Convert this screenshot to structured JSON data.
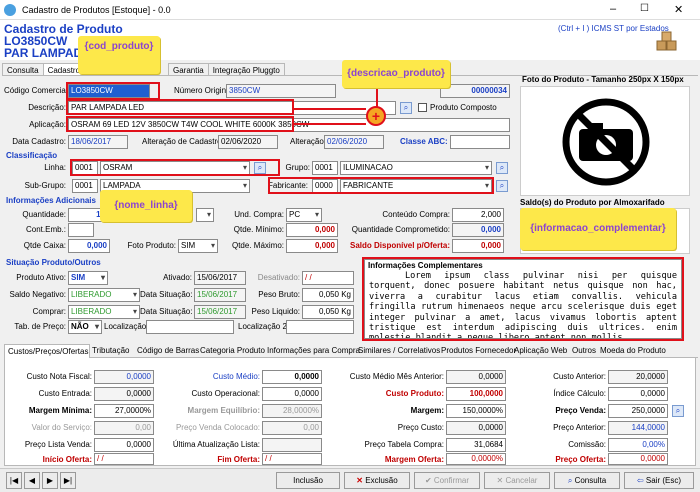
{
  "window": {
    "title": "Cadastro de Produtos [Estoque] - 0.0"
  },
  "header": {
    "title": "Cadastro de Produto",
    "code": "LO3850CW",
    "name": "PAR LAMPADA LED",
    "hint": "(Ctrl + I ) ICMS ST por Estados"
  },
  "top_tabs": [
    "Consulta",
    "Cadastro d",
    "Garantia",
    "Integração Pluggto"
  ],
  "callouts": {
    "cod_produto": "{cod_produto}",
    "descricao_produto": "{descricao_produto}",
    "nome_linha": "{nome_linha}",
    "informacao_complementar": "{informacao_complementar}"
  },
  "id": {
    "cod_label": "Código Comercial:",
    "cod_value": "LO3850CW",
    "orig_label": "Número Original:",
    "orig_value": "3850CW",
    "seq_value": "00000034",
    "desc_label": "Descrição:",
    "desc_value": "PAR LAMPADA LED",
    "composto_label": "Produto Composto",
    "apl_label": "Aplicação:",
    "apl_value": "OSRAM 69 LED 12V 3850CW T4W COOL WHITE 6000K 3850CW",
    "data_cad_label": "Data Cadastro:",
    "data_cad_value": "18/06/2017",
    "alt_cad_label": "Alteração de Cadastro:",
    "alt_cad_value": "02/06/2020",
    "alt_label": "Alteração:",
    "alt_value": "02/06/2020",
    "abc_label": "Classe ABC:"
  },
  "photo": {
    "title": "Foto do Produto - Tamanho 250px X 150px"
  },
  "classif": {
    "title": "Classificação",
    "linha_label": "Linha:",
    "linha_code": "0001",
    "linha_name": "OSRAM",
    "grupo_label": "Grupo:",
    "grupo_code": "0001",
    "grupo_name": "ILUMINACAO",
    "subgrupo_label": "Sub-Grupo:",
    "subgrupo_code": "0001",
    "subgrupo_name": "LAMPADA",
    "fab_label": "Fabricante:",
    "fab_code": "0000",
    "fab_name": "FABRICANTE"
  },
  "saldo_title": "Saldo(s) do Produto por Almoxarifado",
  "adicionais": {
    "title": "Informações Adicionais",
    "qtd_label": "Quantidade:",
    "qtd_value": "10",
    "cont_label": "Cont.Emb.:",
    "qtd_caixa_label": "Qtde Caixa:",
    "qtd_caixa_value": "0,000",
    "foto_label": "Foto Produto:",
    "foto_value": "SIM",
    "und_label": "Und. Compra:",
    "und_value": "PC",
    "qmin_label": "Qtde. Mínimo:",
    "qmin_value": "0,000",
    "qmax_label": "Qtde. Máximo:",
    "qmax_value": "0,000",
    "conteudo_label": "Conteúdo Compra:",
    "conteudo_value": "2,000",
    "comprometido_label": "Quantidade Comprometido:",
    "comprometido_value": "0,000",
    "disponivel_label": "Saldo Disponível p/Oferta:",
    "disponivel_value": "0,000"
  },
  "situacao": {
    "title": "Situação Produto/Outros",
    "ativo_label": "Produto Ativo:",
    "ativo_value": "SIM",
    "ativado_label": "Ativado:",
    "ativado_value": "15/06/2017",
    "desativado_label": "Desativado:",
    "desativado_value": "/ /",
    "saldo_neg_label": "Saldo Negativo:",
    "saldo_neg_value": "LIBERADO",
    "data_sit1_label": "Data Situação:",
    "data_sit1_value": "15/06/2017",
    "peso_bruto_label": "Peso Bruto:",
    "peso_bruto_value": "0,050 Kg",
    "comprar_label": "Comprar:",
    "comprar_value": "LIBERADO",
    "data_sit2_label": "Data Situação:",
    "data_sit2_value": "15/06/2017",
    "peso_liq_label": "Peso Liquido:",
    "peso_liq_value": "0,050 Kg",
    "tab_preco_label": "Tab. de Preço:",
    "tab_preco_value": "NÃO",
    "local_label": "Localização:",
    "local2_label": "Localização 2:"
  },
  "info_comp": {
    "title": "Informações Complementares",
    "text": "Lorem ipsum class pulvinar nisi per quisque torquent, donec posuere habitant netus quisque non hac, viverra a curabitur lacus etiam convallis. vehicula fringilla rutrum himenaeos neque arcu scelerisque duis eget integer pulvinar a amet, lacus vivamus lobortis aptent tristique est interdum adipiscing duis ultrices. enim molestie blandit a neque libero aptent non mollis"
  },
  "bottom_tabs": [
    "Custos/Preços/Ofertas",
    "Tributação",
    "Código de Barras",
    "Categoria Produto",
    "Informações para Compra",
    "Similares / Correlativos",
    "Produtos Fornecedor",
    "Aplicação Web",
    "Outros",
    "Moeda do Produto"
  ],
  "custos": {
    "nota_label": "Custo Nota Fiscal:",
    "nota_value": "0,0000",
    "entrada_label": "Custo Entrada:",
    "entrada_value": "0,0000",
    "margem_min_label": "Margem Mínima:",
    "margem_min_value": "27,0000%",
    "valor_serv_label": "Valor do Serviço:",
    "valor_serv_value": "0,00",
    "lista_venda_label": "Preço Lista Venda:",
    "lista_venda_value": "0,0000",
    "inicio_oferta_label": "Início Oferta:",
    "inicio_oferta_value": "/ /",
    "medio_label": "Custo Médio:",
    "medio_value": "0,0000",
    "operacional_label": "Custo Operacional:",
    "operacional_value": "0,0000",
    "margem_eq_label": "Margem Equilíbrio:",
    "margem_eq_value": "28,0000%",
    "preco_venda_col_label": "Preço Venda Colocado:",
    "preco_venda_col_value": "0,00",
    "ultima_label": "Última Atualização Lista:",
    "fim_oferta_label": "Fim Oferta:",
    "fim_oferta_value": "/ /",
    "medio_ant_label": "Custo Médio Mês Anterior:",
    "medio_ant_value": "0,0000",
    "custo_produto_label": "Custo Produto:",
    "custo_produto_value": "100,0000",
    "margem_label": "Margem:",
    "margem_value": "150,0000%",
    "preco_custo_label": "Preço Custo:",
    "preco_custo_value": "0,0000",
    "tabela_compra_label": "Preço Tabela Compra:",
    "tabela_compra_value": "31,0684",
    "margem_oferta_label": "Margem Oferta:",
    "margem_oferta_value": "0,0000%",
    "anterior_label": "Custo Anterior:",
    "anterior_value": "20,0000",
    "indice_label": "Índice Cálculo:",
    "indice_value": "0,0000",
    "venda_label": "Preço Venda:",
    "venda_value": "250,0000",
    "preco_anterior_label": "Preço Anterior:",
    "preco_anterior_value": "144,0000",
    "comissao_label": "Comissão:",
    "comissao_value": "0,00%",
    "preco_oferta_label": "Preço Oferta:",
    "preco_oferta_value": "0,0000"
  },
  "buttons": {
    "inclusao": "Inclusão",
    "exclusao": "Exclusão",
    "confirmar": "Confirmar",
    "cancelar": "Cancelar",
    "consulta": "Consulta",
    "sair": "Sair (Esc)"
  },
  "colors": {
    "accent": "#1a3fc4",
    "highlight": "#e0101a",
    "callout": "#fde84a"
  }
}
